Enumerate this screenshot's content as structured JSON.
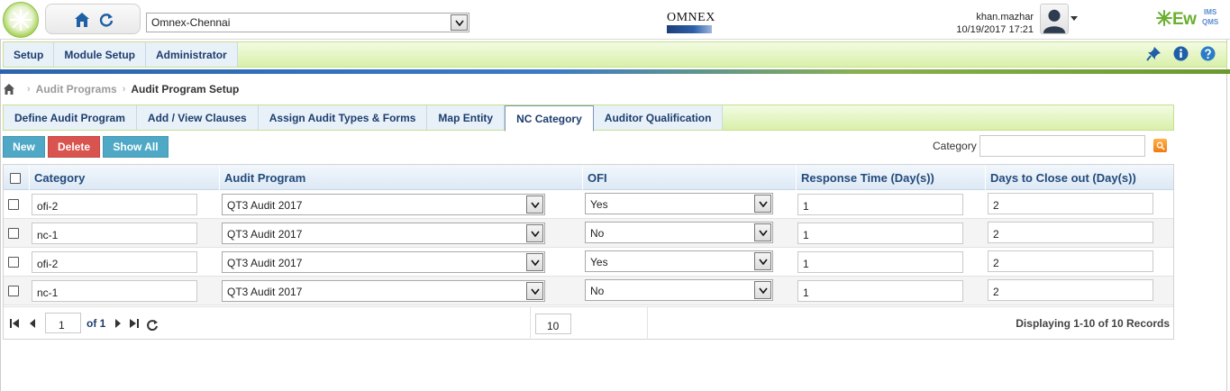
{
  "header": {
    "site_selected": "Omnex-Chennai",
    "brand_logo_text": "OMNEX",
    "user_name": "khan.mazhar",
    "datetime": "10/19/2017 17:21",
    "product_logo": {
      "main": "Ew",
      "top": "IMS",
      "bottom": "QMS"
    },
    "accent_green": "#6ab02f"
  },
  "menu": {
    "items": [
      {
        "label": "Setup"
      },
      {
        "label": "Module Setup"
      },
      {
        "label": "Administrator"
      }
    ],
    "icons": [
      "pin-icon",
      "info-icon",
      "help-icon"
    ]
  },
  "breadcrumb": {
    "items": [
      "Audit Programs",
      "Audit Program Setup"
    ]
  },
  "tabs": {
    "items": [
      {
        "label": "Define Audit Program"
      },
      {
        "label": "Add / View Clauses"
      },
      {
        "label": "Assign Audit Types & Forms"
      },
      {
        "label": "Map Entity"
      },
      {
        "label": "NC Category"
      },
      {
        "label": "Auditor Qualification"
      }
    ],
    "active": "NC Category"
  },
  "actions": {
    "new": "New",
    "delete": "Delete",
    "show_all": "Show All",
    "filter_label": "Category",
    "filter_value": ""
  },
  "grid": {
    "columns": [
      "Category",
      "Audit Program",
      "OFI",
      "Response Time (Day(s))",
      "Days to Close out (Day(s))"
    ],
    "rows": [
      {
        "category": "ofi-2",
        "program": "QT3 Audit 2017",
        "ofi": "Yes",
        "response": "1",
        "close": "2"
      },
      {
        "category": "nc-1",
        "program": "QT3 Audit 2017",
        "ofi": "No",
        "response": "1",
        "close": "2"
      },
      {
        "category": "ofi-2",
        "program": "QT3 Audit 2017",
        "ofi": "Yes",
        "response": "1",
        "close": "2"
      },
      {
        "category": "nc-1",
        "program": "QT3 Audit 2017",
        "ofi": "No",
        "response": "1",
        "close": "2"
      }
    ]
  },
  "pager": {
    "page": "1",
    "of_text": "of 1",
    "page_size": "10",
    "info": "Displaying 1-10 of 10 Records"
  }
}
